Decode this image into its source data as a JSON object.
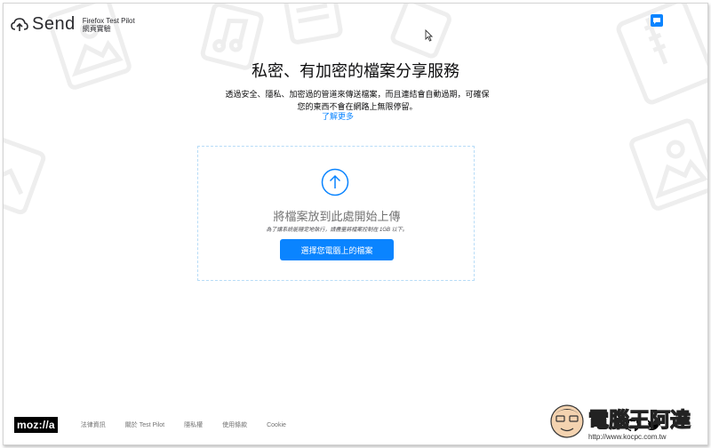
{
  "header": {
    "logo_text": "Send",
    "pilot_line1": "Firefox Test Pilot",
    "pilot_line2": "網頁實驗"
  },
  "main": {
    "title": "私密、有加密的檔案分享服務",
    "description": "透過安全、隱私、加密過的管道來傳送檔案，而且連結會自動過期，可確保您的東西不會在網路上無限停留。",
    "learn_more": "了解更多"
  },
  "dropzone": {
    "title": "將檔案放到此處開始上傳",
    "note": "為了讓系統能穩定地執行，請盡量將檔案控制在 1GB 以下。",
    "button_label": "選擇您電腦上的檔案"
  },
  "footer": {
    "logo": "moz://a",
    "links": [
      "法律資訊",
      "關於 Test Pilot",
      "隱私權",
      "使用條款",
      "Cookie"
    ]
  },
  "watermark": {
    "brand": "電腦王阿達",
    "url": "http://www.kocpc.com.tw"
  },
  "colors": {
    "accent": "#0a84ff",
    "text": "#0c0c0d",
    "muted": "#737373",
    "dropzone_border": "#b7dcf7"
  },
  "icons": {
    "logo": "cloud-arrow-icon",
    "feedback": "speech-bubble-icon",
    "upload": "arrow-up-circle-icon",
    "github": "github-icon",
    "twitter": "twitter-icon"
  }
}
